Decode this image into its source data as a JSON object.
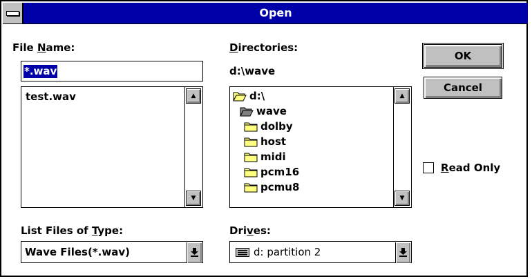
{
  "window": {
    "title": "Open"
  },
  "file_name": {
    "label_pre": "File ",
    "label_accel": "N",
    "label_post": "ame:",
    "value": "*.wav",
    "files": [
      "test.wav"
    ]
  },
  "directories": {
    "label_accel": "D",
    "label_post": "irectories:",
    "current_path": "d:\\wave",
    "items": [
      {
        "name": "d:\\",
        "icon": "open-folder-icon"
      },
      {
        "name": "wave",
        "icon": "open-folder-icon"
      },
      {
        "name": "dolby",
        "icon": "folder-icon"
      },
      {
        "name": "host",
        "icon": "folder-icon"
      },
      {
        "name": "midi",
        "icon": "folder-icon"
      },
      {
        "name": "pcm16",
        "icon": "folder-icon"
      },
      {
        "name": "pcmu8",
        "icon": "folder-icon"
      }
    ]
  },
  "file_type": {
    "label_pre": "List Files of ",
    "label_accel": "T",
    "label_post": "ype:",
    "value": "Wave Files(*.wav)"
  },
  "drives": {
    "label_pre": "Dri",
    "label_accel": "v",
    "label_post": "es:",
    "value": "d: partition 2"
  },
  "buttons": {
    "ok": "OK",
    "cancel": "Cancel"
  },
  "read_only": {
    "label_accel": "R",
    "label_post": "ead Only",
    "checked": false
  },
  "colors": {
    "titlebar": "#0000a8",
    "folder": "#ffff80",
    "button_face": "#c0c0c0"
  }
}
